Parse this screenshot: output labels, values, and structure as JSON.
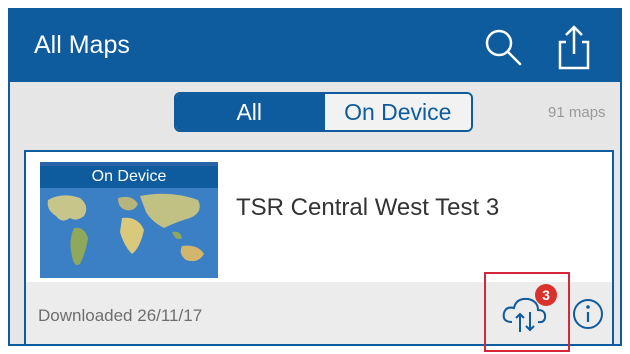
{
  "header": {
    "title": "All Maps",
    "search_icon": "search-icon",
    "share_icon": "share-icon"
  },
  "filter": {
    "options": [
      "All",
      "On Device"
    ],
    "selected": "All",
    "count_text": "91 maps"
  },
  "card": {
    "thumbnail_label": "On Device",
    "map_title": "TSR Central West Test 3",
    "downloaded_text": "Downloaded 26/11/17",
    "sync_icon": "cloud-sync-icon",
    "sync_badge": "3",
    "info_icon": "info-icon"
  },
  "colors": {
    "brand": "#0e5b9d",
    "badge": "#d9322c",
    "highlight": "#d6283a"
  }
}
